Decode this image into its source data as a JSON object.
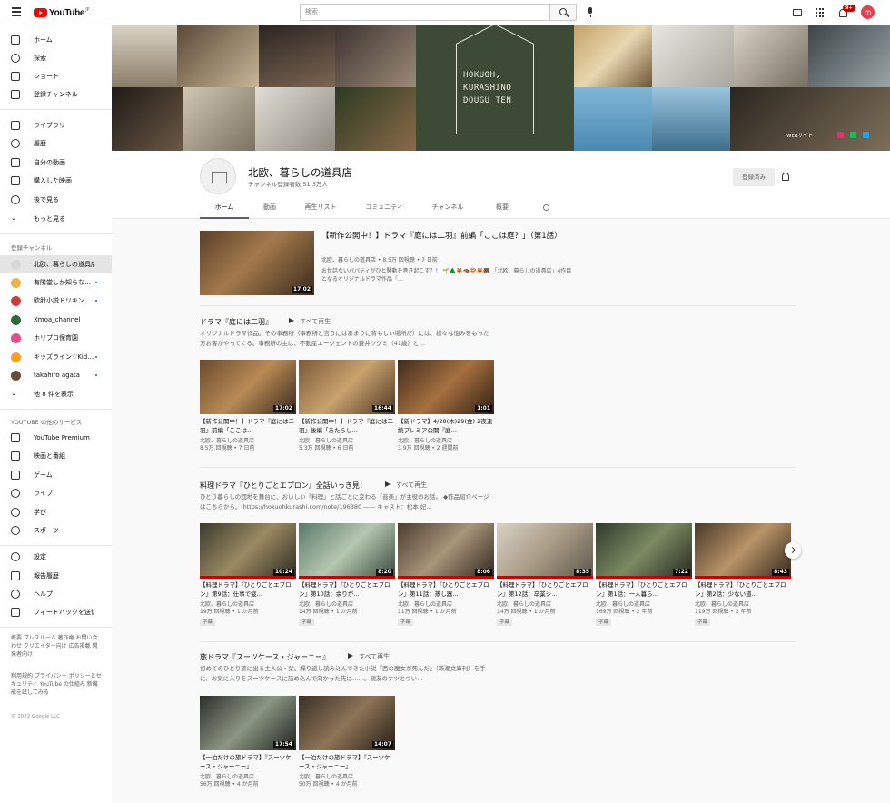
{
  "topbar": {
    "logo_text": "YouTube",
    "logo_reg": "JP",
    "search_placeholder": "検索",
    "notification_count": "9+",
    "avatar_letter": "m"
  },
  "sidebar": {
    "main": [
      {
        "label": "ホーム",
        "icon": "home-icon"
      },
      {
        "label": "探索",
        "icon": "compass-icon"
      },
      {
        "label": "ショート",
        "icon": "shorts-icon"
      },
      {
        "label": "登録チャンネル",
        "icon": "subscriptions-icon"
      }
    ],
    "library": [
      {
        "label": "ライブラリ",
        "icon": "library-icon"
      },
      {
        "label": "履歴",
        "icon": "history-icon"
      },
      {
        "label": "自分の動画",
        "icon": "my-videos-icon"
      },
      {
        "label": "購入した映画",
        "icon": "purchases-icon"
      },
      {
        "label": "後で見る",
        "icon": "watch-later-icon"
      },
      {
        "label": "もっと見る",
        "icon": "chevron-down-icon"
      }
    ],
    "subs_heading": "登録チャンネル",
    "subs": [
      {
        "label": "北欧、暮らしの道具店",
        "color": "#d8d8d8"
      },
      {
        "label": "有隣堂しか知らな…",
        "color": "#e8b34a"
      },
      {
        "label": "欧肘小説ドリキン",
        "color": "#c93d3d"
      },
      {
        "label": "Xmoa_channel",
        "color": "#2e6a3a"
      },
      {
        "label": "ホリプロ保育園",
        "color": "#e04f8a"
      },
      {
        "label": "キッズライン♡Kid…",
        "color": "#ff9f1c"
      },
      {
        "label": "takahiro agata",
        "color": "#6b4b3a"
      }
    ],
    "subs_more": "他 8 件を表示",
    "services_heading": "YOUTUBE の他のサービス",
    "services": [
      {
        "label": "YouTube Premium",
        "icon": "youtube-premium-icon"
      },
      {
        "label": "映画と番組",
        "icon": "movies-icon"
      },
      {
        "label": "ゲーム",
        "icon": "gaming-icon"
      },
      {
        "label": "ライブ",
        "icon": "live-icon"
      },
      {
        "label": "学び",
        "icon": "learning-icon"
      },
      {
        "label": "スポーツ",
        "icon": "sports-icon"
      }
    ],
    "settings": [
      {
        "label": "設定",
        "icon": "gear-icon"
      },
      {
        "label": "報告履歴",
        "icon": "flag-icon"
      },
      {
        "label": "ヘルプ",
        "icon": "help-icon"
      },
      {
        "label": "フィードバックを送信",
        "icon": "feedback-icon"
      }
    ],
    "footer1": "概要 プレスルーム 著作権 お問い合わせ クリエイター向け 広告掲載 開発者向け",
    "footer2": "利用規約 プライバシー ポリシーとセキュリティ YouTube の仕組み 新機能を試してみる",
    "copyright": "© 2022 Google LLC"
  },
  "banner": {
    "logo_line1": "HOKUOH,",
    "logo_line2": "KURASHINO",
    "logo_line3": "DOUGU TEN",
    "web_link": "WEBサイト"
  },
  "channel": {
    "name": "北欧、暮らしの道具店",
    "subscribers": "チャンネル登録者数 51.3万人",
    "subscribe_label": "登録済み",
    "tabs": [
      "ホーム",
      "動画",
      "再生リスト",
      "コミュニティ",
      "チャンネル",
      "概要"
    ]
  },
  "featured": {
    "title": "【新作公開中！】ドラマ『庭には二羽』前編「ここは庭？」（第1話）",
    "meta": "北欧、暮らしの道具店 • 8.5万 回視聴 • 7 日前",
    "description": "お世話ないパパティがひと騒動を巻き起こす？！ 🌱🌲🦊🦔🍄🦊🐻 「北欧、暮らしの道具店」4作目となるオリジナルドラマ作品「…",
    "duration": "17:02"
  },
  "shelves": [
    {
      "title": "ドラマ『庭には二羽』",
      "play_all": "すべて再生",
      "description": "オリジナルドラマ作品。その事務所（事務所と言うにはあまりに背もしい場所だ）には、様々な悩みをもった方お客がやってくる。事務所の主は、不動産エージェントの蒼井ツグミ（41歳）と…",
      "cards": [
        {
          "title": "【新作公開中！】ドラマ『庭には二羽』前編「ここは…",
          "channel": "北欧、暮らしの道具店",
          "meta": "8.5万 回視聴 • 7 日前",
          "duration": "17:02"
        },
        {
          "title": "【新作公開中！】ドラマ『庭には二羽』後編「あたらし…",
          "channel": "北欧、暮らしの道具店",
          "meta": "5.3万 回視聴 • 6 日前",
          "duration": "16:44"
        },
        {
          "title": "【新ドラマ】4/28(木)29(金) 2夜連続プレミア公開『庭…",
          "channel": "北欧、暮らしの道具店",
          "meta": "3.9万 回視聴 • 2 週間前",
          "duration": "1:01"
        }
      ]
    },
    {
      "title": "料理ドラマ『ひとりごとエプロン』全話いっき見！",
      "play_all": "すべて再生",
      "description": "ひとり暮らしの団地を舞台に、おいしい「料理」と話ごとに変わる「音楽」が主役のお話。 ◆作品紹介ページはこちらから。 https://hokuohkurashi.com/note/196380 —— キャスト：松本 妃…",
      "cards": [
        {
          "title": "【料理ドラマ】『ひとりごとエプロン』第9話：仕事で疲…",
          "channel": "北欧、暮らしの道具店",
          "meta": "19万 回視聴 • 1 か月前",
          "duration": "10:24",
          "tag": "字幕"
        },
        {
          "title": "【料理ドラマ】『ひとりごとエプロン』第10話：余りが…",
          "channel": "北欧、暮らしの道具店",
          "meta": "14万 回視聴 • 1 か月前",
          "duration": "8:20",
          "tag": "字幕"
        },
        {
          "title": "【料理ドラマ】『ひとりごとエプロン』第11話：蒸し器…",
          "channel": "北欧、暮らしの道具店",
          "meta": "11万 回視聴 • 1 か月前",
          "duration": "8:06",
          "tag": "字幕"
        },
        {
          "title": "【料理ドラマ】『ひとりごとエプロン』第12話：卒業シ…",
          "channel": "北欧、暮らしの道具店",
          "meta": "14万 回視聴 • 1 か月前",
          "duration": "8:35",
          "tag": "字幕"
        },
        {
          "title": "【料理ドラマ】『ひとりごとエプロン』第1話：一人暮ら…",
          "channel": "北欧、暮らしの道具店",
          "meta": "169万 回視聴 • 2 年前",
          "duration": "7:22",
          "tag": "字幕"
        },
        {
          "title": "【料理ドラマ】『ひとりごとエプロン』第2話：少ない道…",
          "channel": "北欧、暮らしの道具店",
          "meta": "119万 回視聴 • 2 年前",
          "duration": "8:43",
          "tag": "字幕"
        }
      ]
    },
    {
      "title": "旅ドラマ『スーツケース・ジャーニー』",
      "play_all": "すべて再生",
      "description": "初めてのひとり旅に出る主人公・栞。繰り返し読み込んできた小説『西の魔女が死んだ』（新潮文庫刊）を手に、お気に入りをスーツケースに詰め込んで向かった先は……。親友のナツとつい…",
      "cards": [
        {
          "title": "【一泊だけの旅ドラマ】『スーツケース・ジャーニー』…",
          "channel": "北欧、暮らしの道具店",
          "meta": "56万 回視聴 • 4 か月前",
          "duration": "17:54"
        },
        {
          "title": "【一泊だけの旅ドラマ】『スーツケース・ジャーニー』…",
          "channel": "北欧、暮らしの道具店",
          "meta": "50万 回視聴 • 4 か月前",
          "duration": "14:07"
        }
      ]
    }
  ]
}
